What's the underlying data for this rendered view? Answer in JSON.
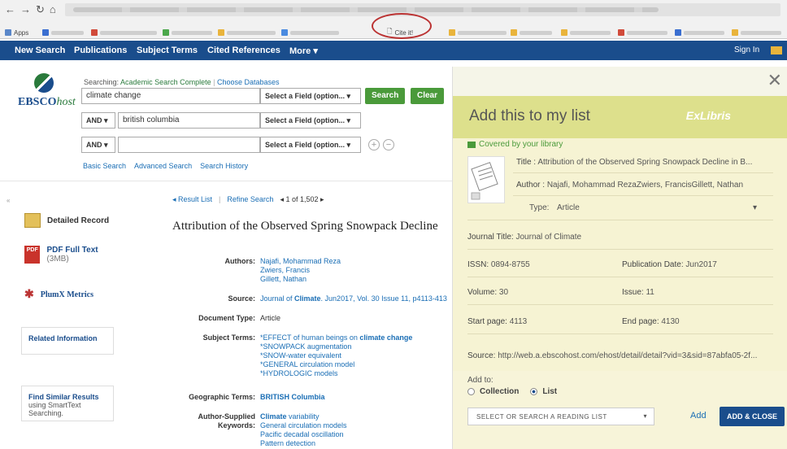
{
  "browser": {
    "bookmarks_apps": "Apps",
    "citeit": "Cite it!"
  },
  "nav": {
    "new_search": "New Search",
    "publications": "Publications",
    "subject_terms": "Subject Terms",
    "cited_references": "Cited References",
    "more": "More ▾",
    "sign_in": "Sign In"
  },
  "search": {
    "logo_ebsco": "EBSCO",
    "logo_host": "host",
    "searching_prefix": "Searching:",
    "database": "Academic Search Complete",
    "choose_databases": "Choose Databases",
    "rows": [
      {
        "op": "",
        "term": "climate change",
        "field": "Select a Field (option... ▾"
      },
      {
        "op": "AND ▾",
        "term": "british columbia",
        "field": "Select a Field (option... ▾"
      },
      {
        "op": "AND ▾",
        "term": "",
        "field": "Select a Field (option... ▾"
      }
    ],
    "search_btn": "Search",
    "clear_btn": "Clear",
    "basic_search": "Basic Search",
    "advanced_search": "Advanced Search",
    "search_history": "Search History"
  },
  "left": {
    "collapse": "«",
    "detailed_record": "Detailed Record",
    "pdf_full_text": "PDF Full Text",
    "pdf_size": "(3MB)",
    "plumx": "PlumX Metrics",
    "related_information": "Related Information",
    "find_similar": "Find Similar Results",
    "find_similar_sub": "using SmartText Searching."
  },
  "record": {
    "result_list": "◂ Result List",
    "refine_search": "Refine Search",
    "count": "◂ 1 of 1,502 ▸",
    "title": "Attribution of the Observed Spring Snowpack Decline",
    "labels": {
      "authors": "Authors:",
      "source": "Source:",
      "doc_type": "Document Type:",
      "subject_terms": "Subject Terms:",
      "geo_terms": "Geographic Terms:",
      "author_supplied": "Author-Supplied",
      "keywords": "Keywords:"
    },
    "authors": [
      "Najafi, Mohammad Reza",
      "Zwiers, Francis",
      "Gillett, Nathan"
    ],
    "source_pre": "Journal of ",
    "source_bold": "Climate",
    "source_post": ". Jun2017, Vol. 30 Issue 11, p4113-413",
    "doc_type": "Article",
    "subject_first_pre": "*EFFECT of human beings on ",
    "subject_first_bold": "climate change",
    "subject_terms": [
      "*SNOWPACK augmentation",
      "*SNOW-water equivalent",
      "*GENERAL circulation model",
      "*HYDROLOGIC models"
    ],
    "geo_terms": "BRITISH Columbia",
    "kw_first_bold": "Climate",
    "kw_first_post": " variability",
    "keywords": [
      "General circulation models",
      "Pacific decadal oscillation",
      "Pattern detection"
    ]
  },
  "overlay": {
    "close": "✕",
    "heading": "Add this to my list",
    "brand": "ExLibris",
    "covered": "Covered by your library",
    "title_k": "Title : ",
    "title_v": "Attribution of the Observed Spring Snowpack Decline in B...",
    "author_k": "Author : ",
    "author_v": "Najafi, Mohammad RezaZwiers, FrancisGillett, Nathan",
    "type_k": "Type:",
    "type_v": "Article",
    "type_caret": "▾",
    "journal_k": "Journal Title: ",
    "journal_v": "Journal of Climate",
    "issn_k": "ISSN: ",
    "issn_v": "0894-8755",
    "pubdate_k": "Publication Date: ",
    "pubdate_v": "Jun2017",
    "volume_k": "Volume: ",
    "volume_v": "30",
    "issue_k": "Issue: ",
    "issue_v": "11",
    "start_k": "Start page: ",
    "start_v": "4113",
    "end_k": "End page: ",
    "end_v": "4130",
    "source_k": "Source: ",
    "source_v": "http://web.a.ebscohost.com/ehost/detail/detail?vid=3&sid=87abfa05-2f...",
    "add_to": "Add to:",
    "collection": "Collection",
    "list": "List",
    "reading_list": "SELECT OR SEARCH A READING LIST",
    "reading_caret": "▾",
    "add": "Add",
    "add_close": "ADD & CLOSE"
  }
}
